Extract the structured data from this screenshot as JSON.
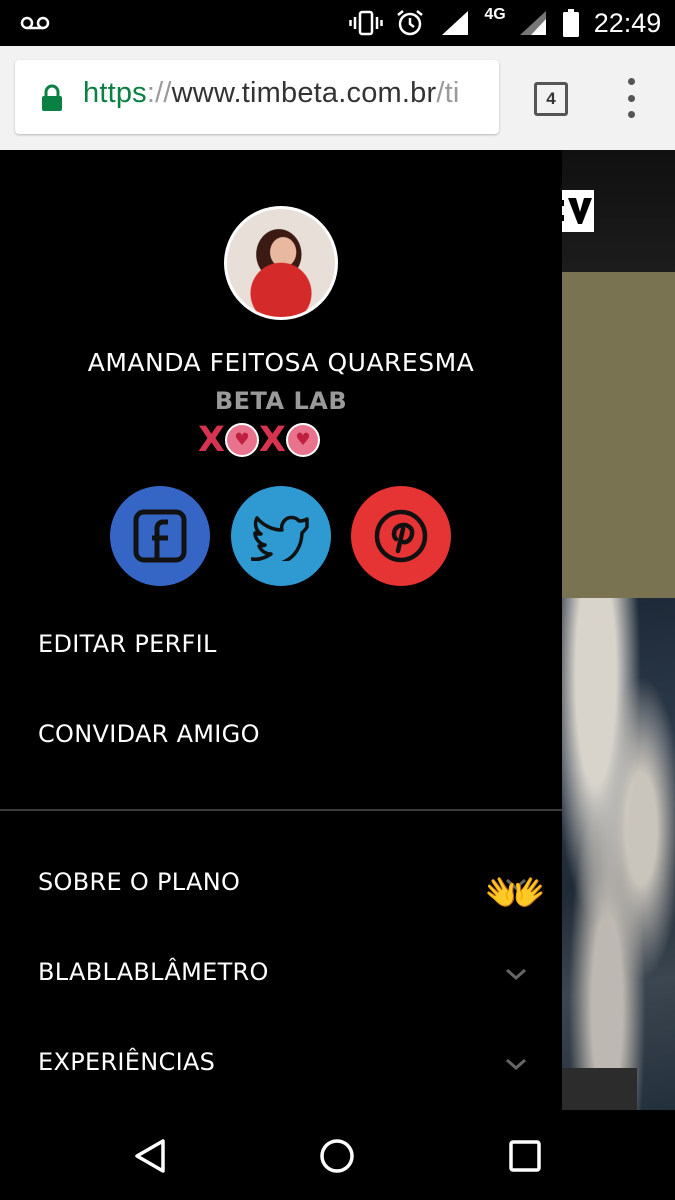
{
  "status_bar": {
    "time": "22:49",
    "network": "4G",
    "icons": [
      "voicemail-icon",
      "vibrate-icon",
      "alarm-icon",
      "signal-icon",
      "signal-secondary-icon",
      "battery-icon"
    ]
  },
  "browser": {
    "url_scheme": "https",
    "url_separator": "://",
    "url_host": "www.timbeta.com.br",
    "url_path": "/ti",
    "tab_count": "4",
    "secure_color": "#0b8043"
  },
  "drawer": {
    "user_name": "AMANDA FEITOSA QUARESMA",
    "user_group": "BETA LAB",
    "badge_letters": [
      "X",
      "X"
    ],
    "social": [
      {
        "name": "facebook",
        "color": "#3566c6"
      },
      {
        "name": "twitter",
        "color": "#2e9ad1"
      },
      {
        "name": "pinterest",
        "color": "#e63434"
      }
    ],
    "menu": {
      "edit_profile": "EDITAR PERFIL",
      "invite_friend": "CONVIDAR AMIGO",
      "about_plan": "SOBRE O PLANO",
      "blablametro": "BLABLABLÂMETRO",
      "experiences": "EXPERIÊNCIAS"
    }
  },
  "overlay": {
    "emoji": "👐"
  }
}
